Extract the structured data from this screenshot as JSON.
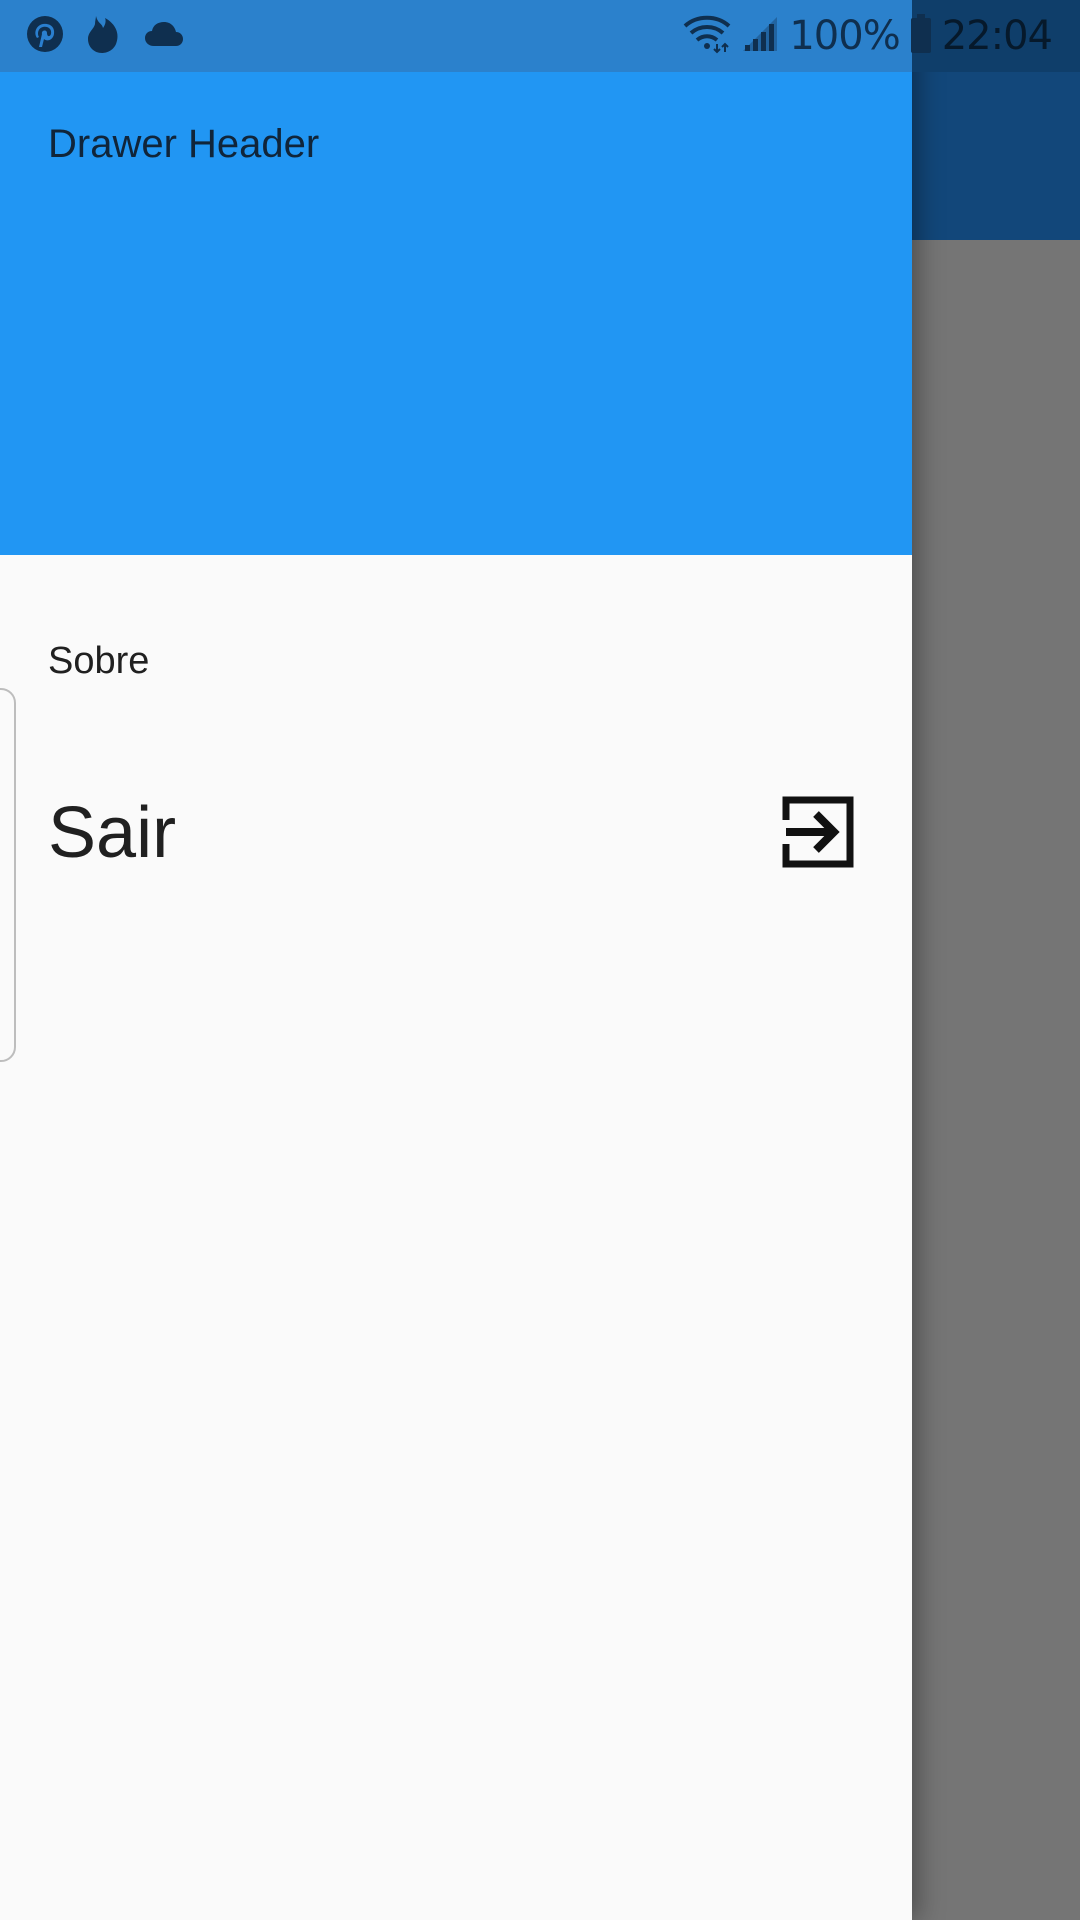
{
  "status_bar": {
    "left_icons": [
      "pinterest-icon",
      "tinder-icon",
      "cloud-icon"
    ],
    "right_icons": [
      "wifi-icon",
      "signal-icon",
      "battery-icon"
    ],
    "battery_text": "100%",
    "time": "22:04"
  },
  "drawer": {
    "header_title": "Drawer Header",
    "header_color": "#2196f3",
    "items": [
      {
        "label": "Sobre"
      },
      {
        "label": "Sair",
        "icon": "exit-to-app-icon"
      }
    ]
  }
}
